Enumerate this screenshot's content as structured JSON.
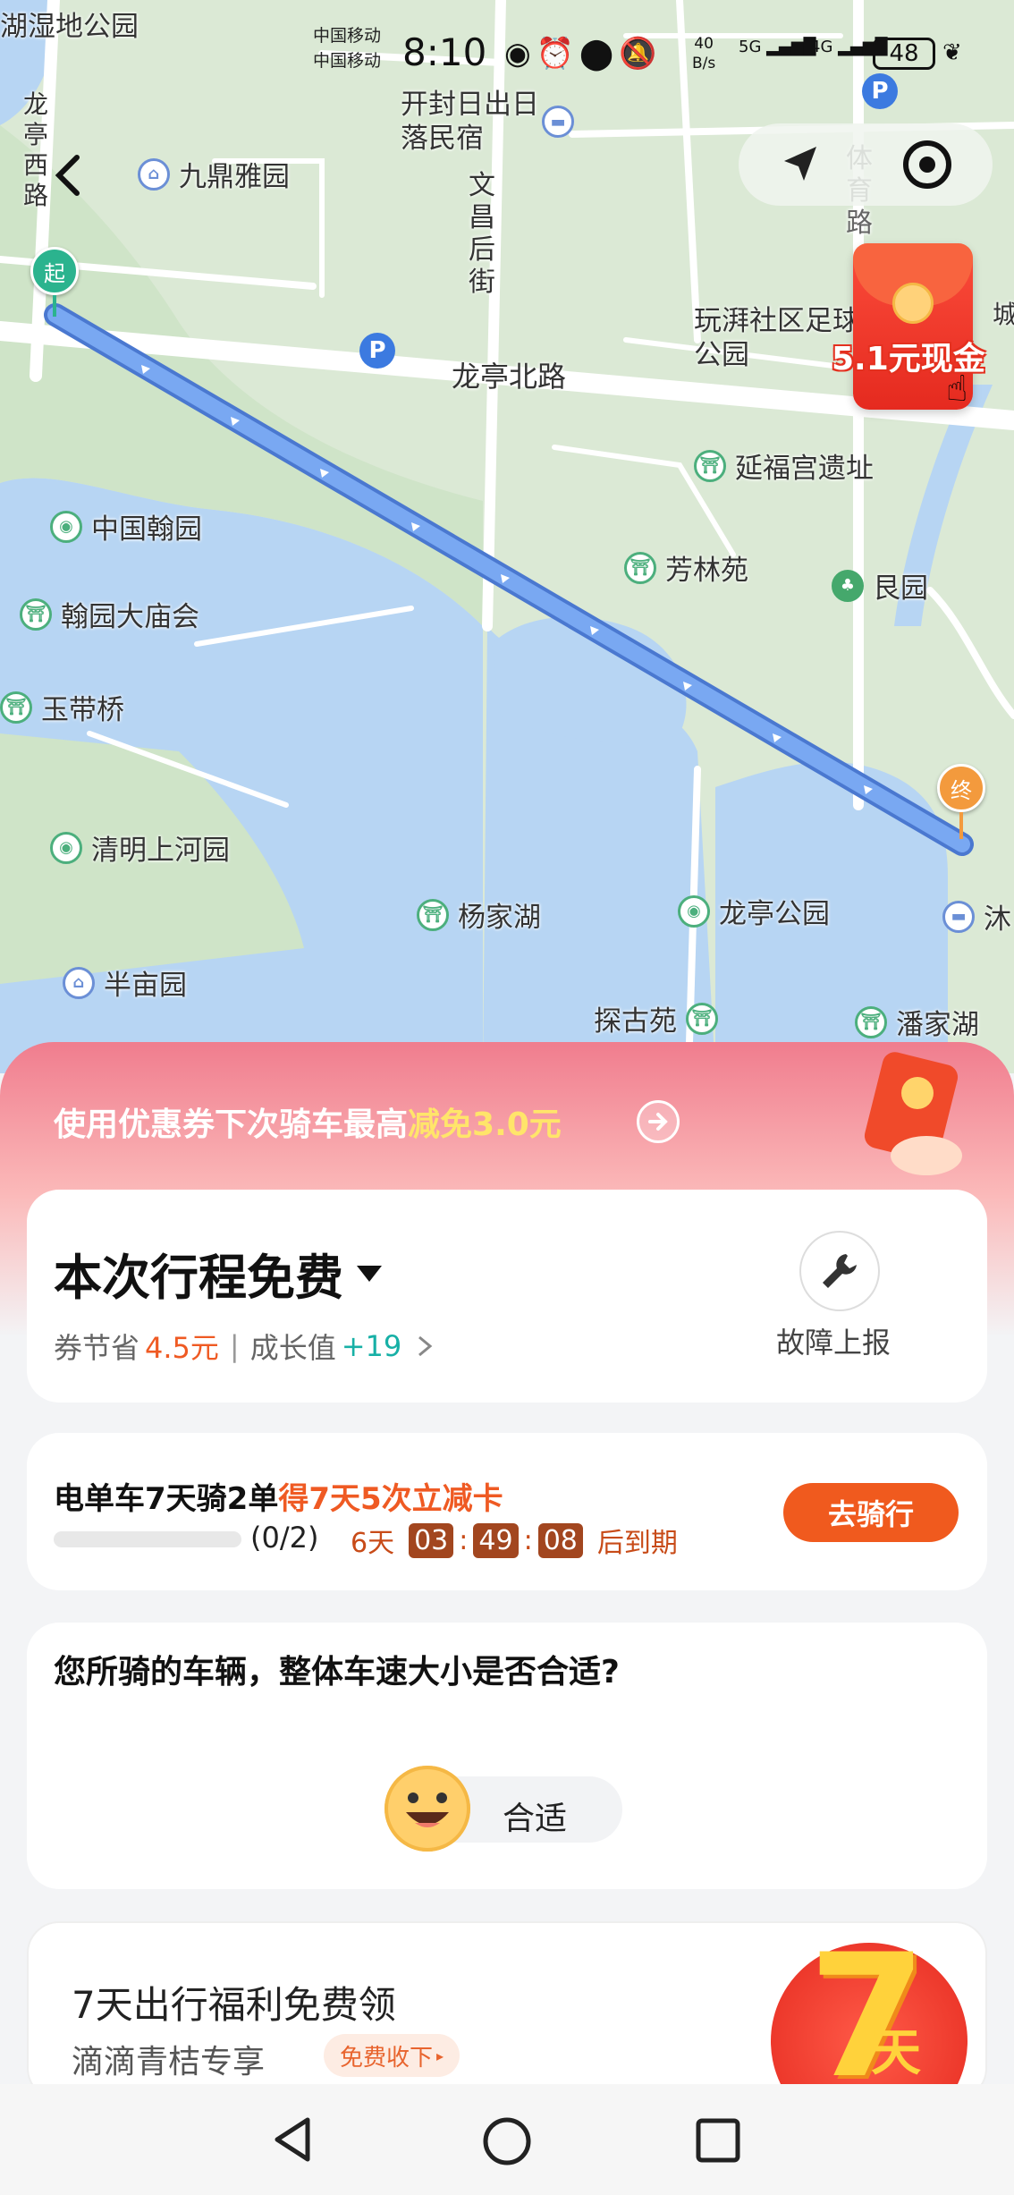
{
  "status_bar": {
    "carrier1": "中国移动",
    "carrier2": "中国移动",
    "time": "8:10",
    "net_speed_value": "40",
    "net_speed_unit": "B/s",
    "net1": "5G",
    "net2": "4G",
    "battery": "48"
  },
  "map": {
    "roads": [
      "龙亭北路",
      "龙亭西路",
      "文昌后街",
      "体育路",
      "城"
    ],
    "pois": [
      {
        "name": "湖湿地公园"
      },
      {
        "name": "九鼎雅园"
      },
      {
        "name": "开封日出日落民宿"
      },
      {
        "name": "玩湃社区足球公园"
      },
      {
        "name": "延福宫遗址"
      },
      {
        "name": "中国翰园"
      },
      {
        "name": "芳林苑"
      },
      {
        "name": "艮园"
      },
      {
        "name": "翰园大庙会"
      },
      {
        "name": "玉带桥"
      },
      {
        "name": "清明上河园"
      },
      {
        "name": "杨家湖"
      },
      {
        "name": "龙亭公园"
      },
      {
        "name": "沐"
      },
      {
        "name": "半亩园"
      },
      {
        "name": "探古苑"
      },
      {
        "name": "潘家湖"
      }
    ],
    "start_marker": "起",
    "end_marker": "终",
    "red_packet_label": "5.1元现金"
  },
  "promo_banner": {
    "text_before": "使用优惠券下次骑车最高",
    "text_highlight": "减免3.0元"
  },
  "trip_card": {
    "title": "本次行程免费",
    "saving_label": "券节省",
    "saving_value": "4.5元",
    "separator": "|",
    "growth_label": "成长值",
    "growth_value": "+19",
    "report_label": "故障上报"
  },
  "challenge_card": {
    "title_before": "电单车7天骑2单",
    "title_highlight": "得7天5次立减卡",
    "progress_text": "(0/2)",
    "progress_value": 0,
    "countdown_days": "6天",
    "countdown_h": "03",
    "countdown_m": "49",
    "countdown_s": "08",
    "countdown_suffix": "后到期",
    "button": "去骑行"
  },
  "survey_card": {
    "question": "您所骑的车辆，整体车速大小是否合适?",
    "option": "合适"
  },
  "welfare_card": {
    "title": "7天出行福利免费领",
    "subtitle": "滴滴青桔专享",
    "tag": "免费收下",
    "badge_number": "7",
    "badge_text": "天"
  },
  "colors": {
    "route": "#5b8fe8",
    "accent_orange": "#f05a1e",
    "teal": "#17b0a6",
    "map_bg": "#dbe9d5",
    "water": "#b7d5f3"
  }
}
